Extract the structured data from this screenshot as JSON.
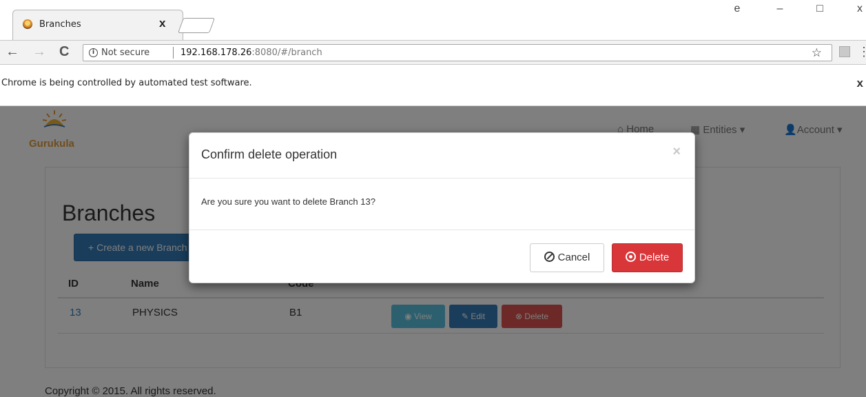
{
  "browser": {
    "tab_title": "Branches",
    "tab_close": "x",
    "window_buttons": [
      "e",
      "–",
      "□",
      "x"
    ],
    "security_label": "Not secure",
    "url_host": "192.168.178.26",
    "url_rest": ":8080/#/branch",
    "infobar_text": "Chrome is being controlled by automated test software.",
    "infobar_close": "x"
  },
  "app": {
    "brand": "Gurukula",
    "nav": {
      "home": "Home",
      "entities": "Entities",
      "account": "Account"
    },
    "page_title": "Branches",
    "create_button": "Create a new Branch",
    "table": {
      "headers": [
        "ID",
        "Name",
        "Code"
      ],
      "rows": [
        {
          "id": "13",
          "name": "PHYSICS",
          "code": "B1",
          "actions": [
            "View",
            "Edit",
            "Delete"
          ]
        }
      ]
    },
    "footer": "Copyright © 2015. All rights reserved."
  },
  "modal": {
    "title": "Confirm delete operation",
    "close": "×",
    "message": "Are you sure you want to delete Branch 13?",
    "cancel_label": "Cancel",
    "delete_label": "Delete"
  },
  "colors": {
    "primary": "#337ab7",
    "info": "#5bc0de",
    "danger": "#d9363a",
    "brand": "#e09a3a"
  }
}
